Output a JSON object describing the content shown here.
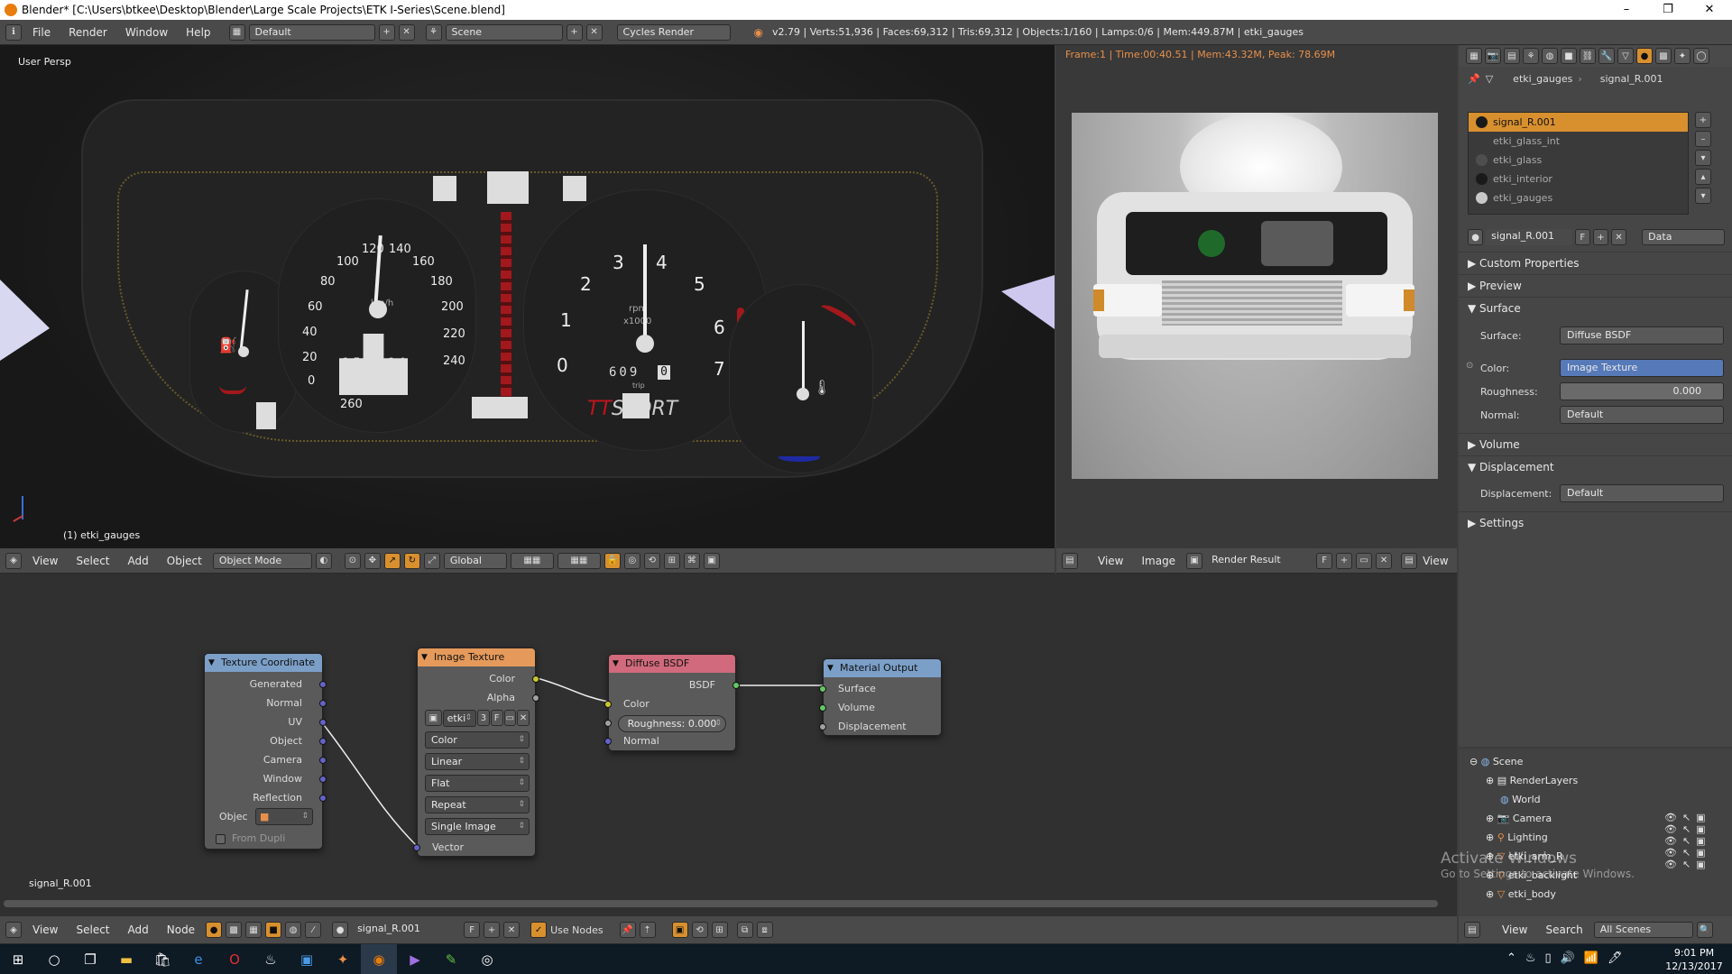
{
  "window": {
    "title": "Blender* [C:\\Users\\btkee\\Desktop\\Blender\\Large Scale Projects\\ETK I-Series\\Scene.blend]",
    "minimize": "–",
    "maximize": "❐",
    "close": "✕"
  },
  "topbar": {
    "menus": [
      "File",
      "Render",
      "Window",
      "Help"
    ],
    "layout": "Default",
    "scene": "Scene",
    "engine": "Cycles Render",
    "stats": "v2.79 | Verts:51,936 | Faces:69,312 | Tris:69,312 | Objects:1/160 | Lamps:0/6 | Mem:449.87M | etki_gauges"
  },
  "viewport": {
    "label": "User Persp",
    "object": "(1) etki_gauges",
    "speedo": [
      "260",
      "240",
      "220",
      "200",
      "180",
      "160",
      "140",
      "120",
      "100",
      "80",
      "60",
      "40",
      "20",
      "0"
    ],
    "speedo_unit": "km/h",
    "odo": "152864",
    "tacho": [
      "0",
      "1",
      "2",
      "3",
      "4",
      "5",
      "6",
      "7"
    ],
    "tacho_unit1": "rpm",
    "tacho_unit2": "x1000",
    "trip": "609",
    "trip_last": "0",
    "trip_label": "trip",
    "brand_a": "TT",
    "brand_b": "SPORT"
  },
  "view3d_header": {
    "menus": [
      "View",
      "Select",
      "Add",
      "Object"
    ],
    "mode": "Object Mode",
    "orientation": "Global"
  },
  "render": {
    "info": "Frame:1 | Time:00:40.51 | Mem:43.32M, Peak: 78.69M"
  },
  "image_header": {
    "menus": [
      "View",
      "Image"
    ],
    "image": "Render Result",
    "fake": "F",
    "view": "View"
  },
  "props": {
    "breadcrumb_a": "etki_gauges",
    "breadcrumb_b": "signal_R.001",
    "materials": [
      {
        "name": "signal_R.001",
        "color": "#1a1a1a"
      },
      {
        "name": "etki_glass_int",
        "color": "#3a3a3a"
      },
      {
        "name": "etki_glass",
        "color": "#4e4e4e"
      },
      {
        "name": "etki_interior",
        "color": "#1a1a1a"
      },
      {
        "name": "etki_gauges",
        "color": "#c8c8c8"
      }
    ],
    "material_name": "signal_R.001",
    "fake": "F",
    "link": "Data",
    "panels": {
      "custom": "Custom Properties",
      "preview": "Preview",
      "surface": "Surface",
      "volume": "Volume",
      "displacement": "Displacement",
      "settings": "Settings"
    },
    "surface_label": "Surface:",
    "surface_value": "Diffuse BSDF",
    "color_label": "Color:",
    "color_value": "Image Texture",
    "rough_label": "Roughness:",
    "rough_value": "0.000",
    "normal_label": "Normal:",
    "normal_value": "Default",
    "disp_label": "Displacement:",
    "disp_value": "Default"
  },
  "nodes": {
    "texcoord": {
      "title": "Texture Coordinate",
      "outputs": [
        "Generated",
        "Normal",
        "UV",
        "Object",
        "Camera",
        "Window",
        "Reflection"
      ],
      "object_label": "Objec",
      "from_dupli": "From Dupli"
    },
    "image": {
      "title": "Image Texture",
      "out_color": "Color",
      "out_alpha": "Alpha",
      "img": "etki",
      "users": "3",
      "fake": "F",
      "color": "Color",
      "interp": "Linear",
      "proj": "Flat",
      "ext": "Repeat",
      "source": "Single Image",
      "vector": "Vector"
    },
    "diffuse": {
      "title": "Diffuse BSDF",
      "out": "BSDF",
      "color": "Color",
      "roughness": "Roughness: 0.000",
      "normal": "Normal"
    },
    "output": {
      "title": "Material Output",
      "surface": "Surface",
      "volume": "Volume",
      "displacement": "Displacement"
    },
    "material_label": "signal_R.001"
  },
  "node_header": {
    "menus": [
      "View",
      "Select",
      "Add",
      "Node"
    ],
    "material": "signal_R.001",
    "fake": "F",
    "use_nodes": "Use Nodes"
  },
  "outliner": {
    "items": [
      "Scene",
      "RenderLayers",
      "World",
      "Camera",
      "Lighting",
      "etki_arm_R",
      "etki_backlight",
      "etki_body"
    ],
    "menus": [
      "View",
      "Search"
    ],
    "filter": "All Scenes"
  },
  "watermark": {
    "line1": "Activate Windows",
    "line2": "Go to Settings to activate Windows."
  },
  "taskbar": {
    "time": "9:01 PM",
    "date": "12/13/2017"
  }
}
